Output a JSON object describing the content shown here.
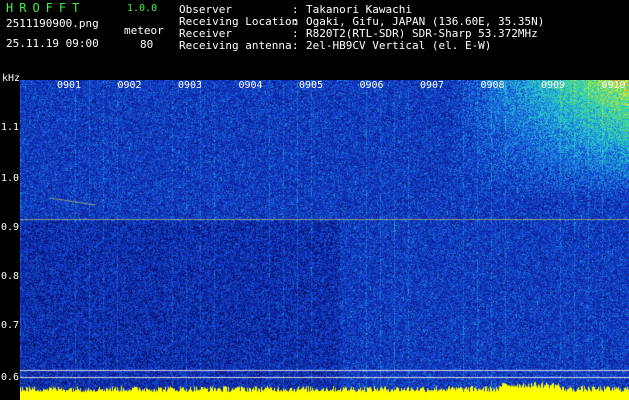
{
  "header": {
    "brand": "HROFFT",
    "version": "1.0.0",
    "filename": "2511190900.png",
    "datetime": "25.11.19 09:00",
    "meteor_label": "meteor",
    "meteor_count": "80"
  },
  "info": [
    {
      "label": "Observer",
      "value": "Takanori Kawachi"
    },
    {
      "label": "Receiving Location",
      "value": "Ogaki, Gifu, JAPAN (136.60E, 35.35N)"
    },
    {
      "label": "Receiver",
      "value": "R820T2(RTL-SDR) SDR-Sharp 53.372MHz"
    },
    {
      "label": "Receiving antenna",
      "value": "2el-HB9CV Vertical (el. E-W)"
    }
  ],
  "axis": {
    "unit": "kHz",
    "y_ticks": [
      "1.1",
      "1.0",
      "0.9",
      "0.8",
      "0.7",
      "0.6"
    ],
    "time_labels": [
      "0901",
      "0902",
      "0903",
      "0904",
      "0905",
      "0906",
      "0907",
      "0908",
      "0909",
      "0910"
    ]
  },
  "colors": {
    "text": "#ffffff",
    "brand": "#44ee44",
    "spectrum_base": "#0a1e8c",
    "signal_line": "#e6e65a",
    "noise_floor": "#ffff00"
  }
}
